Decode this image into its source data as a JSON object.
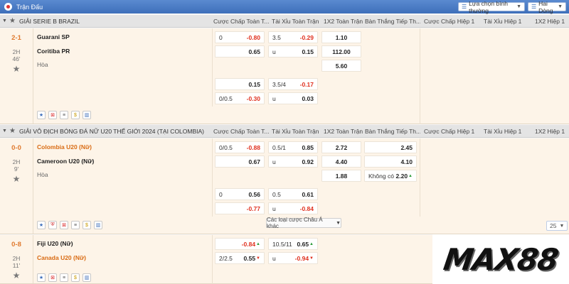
{
  "header": {
    "title": "Trận Đấu",
    "sort_select": "Lựa chọn bình thường",
    "region_select": "Hai Dòng"
  },
  "columns": [
    "Cược Chấp Toàn T...",
    "Tài Xỉu Toàn Trận",
    "1X2 Toàn Trận",
    "Bàn Thắng Tiếp Th...",
    "Cược Chấp Hiệp 1",
    "Tài Xỉu Hiệp 1",
    "1X2 Hiệp 1"
  ],
  "leagues": [
    {
      "name": "GIẢI SERIE B BRAZIL",
      "match": {
        "score": "2-1",
        "half": "2H",
        "minute": "46'",
        "home": "Guarani SP",
        "away": "Coritiba PR",
        "draw": "Hòa",
        "hdp": [
          [
            "0",
            "-0.80"
          ],
          [
            "",
            "0.65"
          ],
          [
            "",
            "0.15"
          ],
          [
            "0/0.5",
            "-0.30"
          ]
        ],
        "ou": [
          [
            "3.5",
            "-0.29"
          ],
          [
            "u",
            "0.15"
          ],
          [
            "3.5/4",
            "-0.17"
          ],
          [
            "u",
            "0.03"
          ]
        ],
        "x12": [
          "1.10",
          "112.00",
          "5.60"
        ]
      }
    },
    {
      "name": "GIẢI VÔ ĐỊCH BÓNG ĐÁ NỮ U20 THẾ GIỚI 2024 (TẠI COLOMBIA)",
      "match": {
        "score": "0-0",
        "half": "2H",
        "minute": "9'",
        "home": "Colombia U20 (Nữ)",
        "away": "Cameroon U20 (Nữ)",
        "draw": "Hòa",
        "hdp": [
          [
            "0/0.5",
            "-0.88"
          ],
          [
            "",
            "0.67"
          ],
          [
            "0",
            "0.56"
          ],
          [
            "",
            "-0.77"
          ]
        ],
        "ou": [
          [
            "0.5/1",
            "0.85"
          ],
          [
            "u",
            "0.92"
          ],
          [
            "0.5",
            "0.61"
          ],
          [
            "u",
            "-0.84"
          ]
        ],
        "x12": [
          "2.72",
          "4.40",
          "1.88"
        ],
        "ng": [
          [
            "",
            "2.45"
          ],
          [
            "",
            "4.10"
          ],
          [
            "Không có",
            "2.20"
          ]
        ]
      },
      "more_label": "Các loại cược Châu Á khác",
      "page_size": "25"
    },
    {
      "match": {
        "score": "0-8",
        "half": "2H",
        "minute": "11'",
        "home": "Fiji U20 (Nữ)",
        "away": "Canada U20 (Nữ)",
        "hdp": [
          [
            "",
            "-0.84"
          ],
          [
            "2/2.5",
            "0.55"
          ]
        ],
        "ou": [
          [
            "10.5/11",
            "0.65"
          ],
          [
            "u",
            "-0.94"
          ]
        ]
      }
    }
  ],
  "brand": {
    "text": "MAX88"
  },
  "colors": {
    "header_bg": "#3e6fba",
    "favorite": "#d96b13",
    "negative": "#e0301e",
    "up": "#2e9d3a"
  }
}
